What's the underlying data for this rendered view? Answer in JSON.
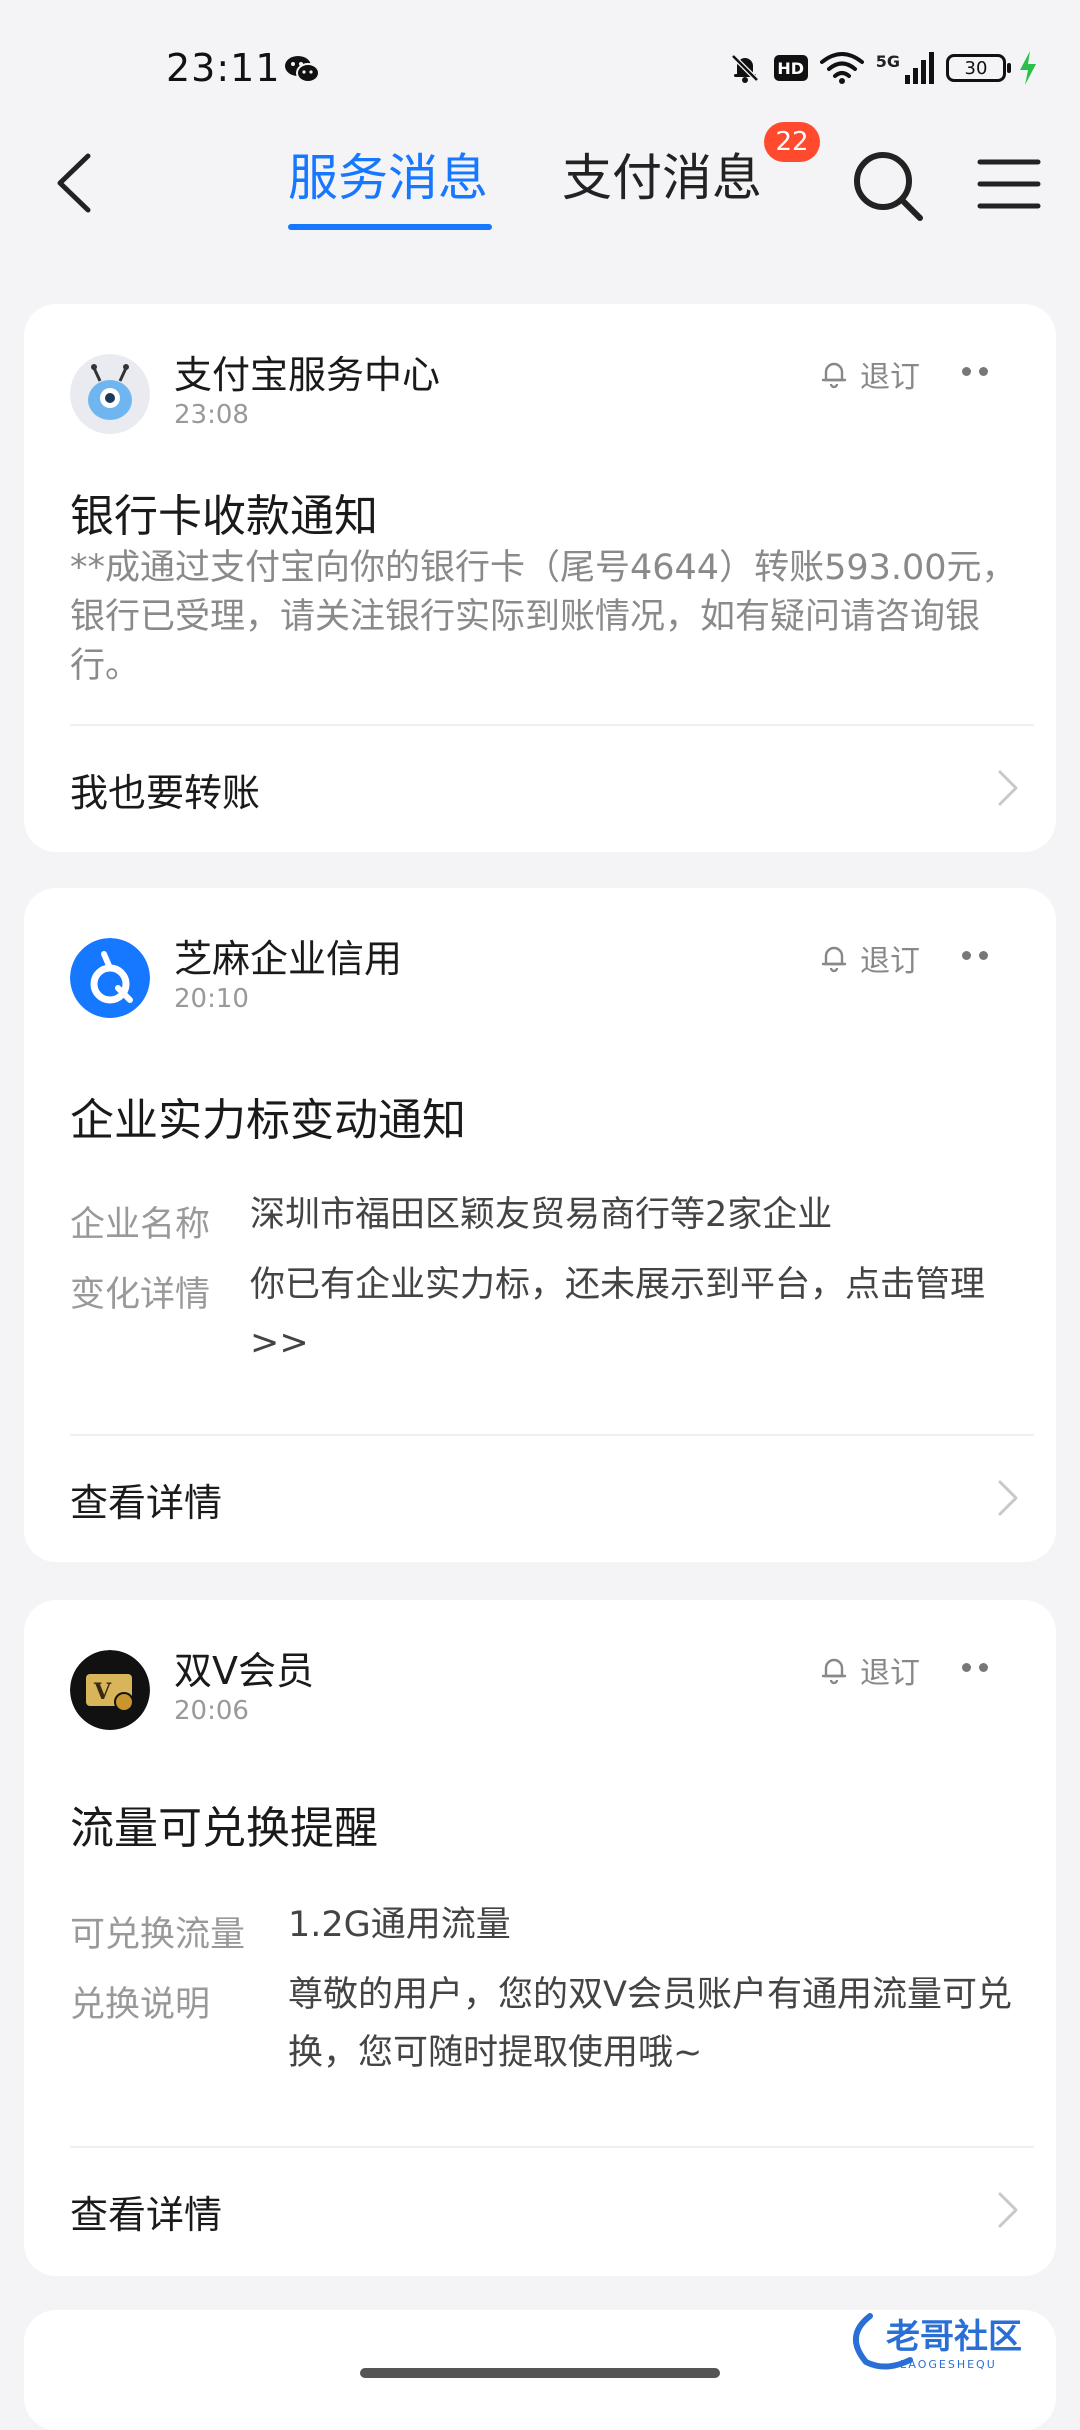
{
  "status": {
    "time": "23:11",
    "network": "5G",
    "battery": "30",
    "icons": [
      "wechat-icon",
      "mute-bell-icon",
      "hd-icon",
      "wifi-icon",
      "signal-icon",
      "battery-icon",
      "charging-icon"
    ]
  },
  "nav": {
    "tab_service": "服务消息",
    "tab_payment": "支付消息",
    "payment_badge": "22",
    "accent_color": "#1677ff",
    "badge_color": "#ff4a2e"
  },
  "cards": [
    {
      "source": "支付宝服务中心",
      "time": "23:08",
      "unsubscribe": "退订",
      "title": "银行卡收款通知",
      "body": "**成通过支付宝向你的银行卡（尾号4644）转账593.00元，银行已受理，请关注银行实际到账情况，如有疑问请咨询银行。",
      "action": "我也要转账"
    },
    {
      "source": "芝麻企业信用",
      "time": "20:10",
      "unsubscribe": "退订",
      "title": "企业实力标变动通知",
      "fields": [
        {
          "label": "企业名称",
          "value": "深圳市福田区颖友贸易商行等2家企业"
        },
        {
          "label": "变化详情",
          "value": "你已有企业实力标，还未展示到平台，点击管理>>"
        }
      ],
      "action": "查看详情"
    },
    {
      "source": "双V会员",
      "time": "20:06",
      "unsubscribe": "退订",
      "title": "流量可兑换提醒",
      "fields": [
        {
          "label": "可兑换流量",
          "value": "1.2G通用流量"
        },
        {
          "label": "兑换说明",
          "value": "尊敬的用户，您的双V会员账户有通用流量可兑换，您可随时提取使用哦~"
        }
      ],
      "action": "查看详情"
    }
  ],
  "watermark": {
    "text": "老哥社区",
    "sub": "LAOGESHEQU"
  }
}
